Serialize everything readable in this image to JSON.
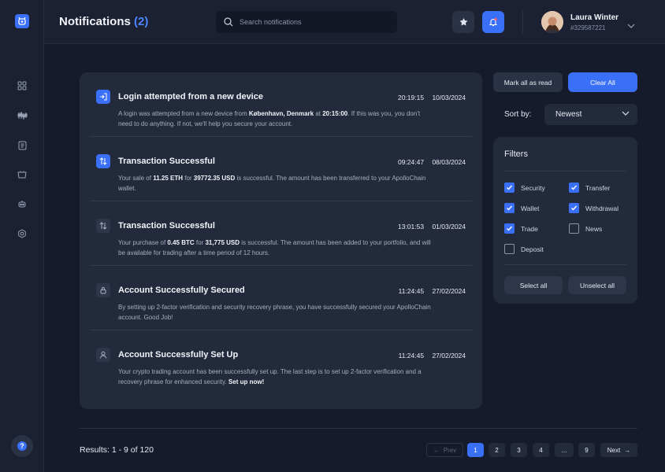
{
  "header": {
    "title": "Notifications",
    "count": "(2)",
    "search_placeholder": "Search notifications",
    "user": {
      "name": "Laura Winter",
      "id": "#329587221"
    }
  },
  "sidebar": {
    "icons": [
      "logo-icon",
      "dashboard-icon",
      "markets-icon",
      "document-icon",
      "store-icon",
      "robot-icon",
      "settings-icon",
      "help-icon"
    ],
    "help_label": "?"
  },
  "notifications": [
    {
      "icon": "login-icon",
      "title": "Login attempted from a new device",
      "time": "20:19:15",
      "date": "10/03/2024",
      "body": [
        {
          "t": "A login was attempted from a new device from "
        },
        {
          "b": "København, Denmark"
        },
        {
          "t": " at "
        },
        {
          "b": "20:15:00"
        },
        {
          "t": ". If this was you, you don't need to do anything. If not, we'll help you secure your account."
        }
      ]
    },
    {
      "icon": "transfer-icon",
      "title": "Transaction Successful",
      "time": "09:24:47",
      "date": "08/03/2024",
      "body": [
        {
          "t": "Your sale of "
        },
        {
          "b": "11.25 ETH"
        },
        {
          "t": " for "
        },
        {
          "b": "39772.35 USD"
        },
        {
          "t": " is successful. The amount has been transferred to your ApolloChain wallet."
        }
      ]
    },
    {
      "icon": "transfer-icon",
      "title": "Transaction Successful",
      "time": "13:01:53",
      "date": "01/03/2024",
      "body": [
        {
          "t": "Your purchase of "
        },
        {
          "b": "0.45 BTC"
        },
        {
          "t": " for "
        },
        {
          "b": "31,775 USD"
        },
        {
          "t": " is successful. The amount has been added to your portfolio, and will be available for trading after a time period of 12 hours."
        }
      ]
    },
    {
      "icon": "lock-icon",
      "title": "Account Successfully Secured",
      "time": "11:24:45",
      "date": "27/02/2024",
      "body": [
        {
          "t": "By setting up 2-factor verification and security recovery phrase, you have successfully secured your ApolloChain account. Good Job!"
        }
      ]
    },
    {
      "icon": "user-icon",
      "title": "Account Successfully Set Up",
      "time": "11:24:45",
      "date": "27/02/2024",
      "body": [
        {
          "t": "Your crypto trading account has been successfully set up. The last step is to set up 2-factor verification and a recovery phrase for enhanced security. "
        },
        {
          "b": "Set up now!"
        }
      ]
    }
  ],
  "actions": {
    "mark_all": "Mark all as read",
    "clear_all": "Clear All"
  },
  "sort": {
    "label": "Sort by:",
    "value": "Newest"
  },
  "filters": {
    "title": "Filters",
    "items": [
      {
        "label": "Security",
        "checked": true
      },
      {
        "label": "Transfer",
        "checked": true
      },
      {
        "label": "Wallet",
        "checked": true
      },
      {
        "label": "Withdrawal",
        "checked": true
      },
      {
        "label": "Trade",
        "checked": true
      },
      {
        "label": "News",
        "checked": false
      },
      {
        "label": "Deposit",
        "checked": false
      }
    ],
    "select_all": "Select all",
    "unselect_all": "Unselect all"
  },
  "pagination": {
    "results": "Results: 1 - 9 of 120",
    "prev": "Prev",
    "next": "Next",
    "pages": [
      "1",
      "2",
      "3",
      "4",
      "...",
      "9"
    ],
    "current": "1"
  },
  "colors": {
    "accent": "#3a6ff7",
    "background": "#161b2b",
    "panel": "#232a3b"
  }
}
